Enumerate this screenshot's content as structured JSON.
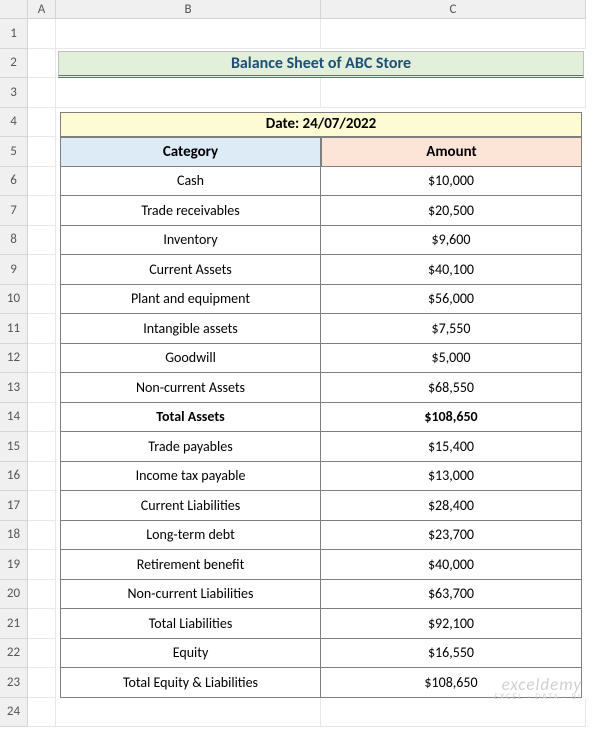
{
  "columns": [
    "A",
    "B",
    "C"
  ],
  "rowCount": 24,
  "title": "Balance Sheet of ABC Store",
  "dateLabel": "Date: 24/07/2022",
  "headers": {
    "category": "Category",
    "amount": "Amount"
  },
  "rows": [
    {
      "category": "Cash",
      "amount": "$10,000",
      "bold": false
    },
    {
      "category": "Trade receivables",
      "amount": "$20,500",
      "bold": false
    },
    {
      "category": "Inventory",
      "amount": "$9,600",
      "bold": false
    },
    {
      "category": "Current Assets",
      "amount": "$40,100",
      "bold": false
    },
    {
      "category": "Plant and equipment",
      "amount": "$56,000",
      "bold": false
    },
    {
      "category": "Intangible assets",
      "amount": "$7,550",
      "bold": false
    },
    {
      "category": "Goodwill",
      "amount": "$5,000",
      "bold": false
    },
    {
      "category": "Non-current Assets",
      "amount": "$68,550",
      "bold": false
    },
    {
      "category": "Total Assets",
      "amount": "$108,650",
      "bold": true
    },
    {
      "category": "Trade payables",
      "amount": "$15,400",
      "bold": false
    },
    {
      "category": "Income tax payable",
      "amount": "$13,000",
      "bold": false
    },
    {
      "category": "Current Liabilities",
      "amount": "$28,400",
      "bold": false
    },
    {
      "category": "Long-term debt",
      "amount": "$23,700",
      "bold": false
    },
    {
      "category": "Retirement benefit",
      "amount": "$40,000",
      "bold": false
    },
    {
      "category": "Non-current Liabilities",
      "amount": "$63,700",
      "bold": false
    },
    {
      "category": "Total Liabilities",
      "amount": "$92,100",
      "bold": false
    },
    {
      "category": "Equity",
      "amount": "$16,550",
      "bold": false
    },
    {
      "category": "Total Equity & Liabilities",
      "amount": "$108,650",
      "bold": false
    }
  ],
  "watermark": {
    "line1": "exceldemy",
    "line2": "EXCEL · DATA · BI"
  }
}
